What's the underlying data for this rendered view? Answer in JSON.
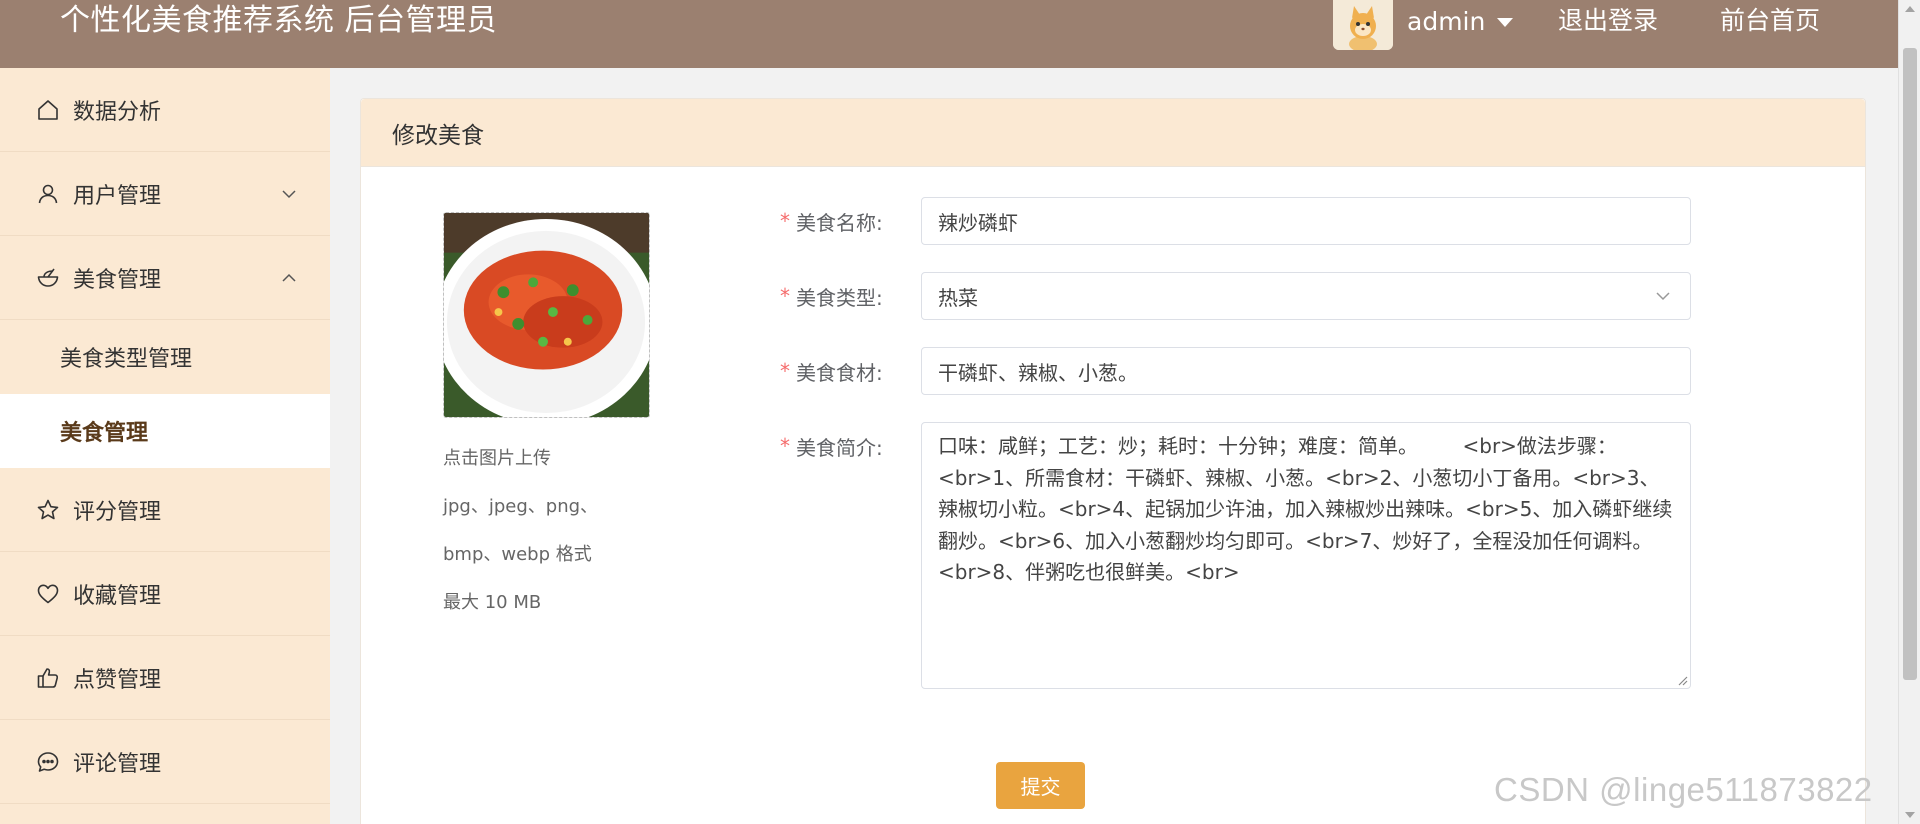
{
  "header": {
    "title": "个性化美食推荐系统 后台管理员",
    "username": "admin",
    "logout": "退出登录",
    "home": "前台首页",
    "avatar_icon": "cartoon-cat-avatar",
    "background": "#9b8070"
  },
  "sidebar": {
    "background": "#fbe9d3",
    "items": [
      {
        "label": "数据分析",
        "icon": "home-icon"
      },
      {
        "label": "用户管理",
        "icon": "user-icon",
        "arrow": "chevron-down"
      },
      {
        "label": "美食管理",
        "icon": "bowl-icon",
        "arrow": "chevron-up",
        "expanded": true
      },
      {
        "label": "美食类型管理",
        "sub": true
      },
      {
        "label": "美食管理",
        "sub": true,
        "active": true
      },
      {
        "label": "评分管理",
        "icon": "star-icon"
      },
      {
        "label": "收藏管理",
        "icon": "heart-icon"
      },
      {
        "label": "点赞管理",
        "icon": "thumb-up-icon"
      },
      {
        "label": "评论管理",
        "icon": "comment-icon"
      }
    ]
  },
  "card": {
    "title": "修改美食"
  },
  "upload": {
    "image_icon": "fried-shrimp-dish-image",
    "hint1": "点击图片上传",
    "hint2": "jpg、jpeg、png、",
    "hint3": "bmp、webp 格式",
    "hint4": "最大 10 MB"
  },
  "form": {
    "name_label": "美食名称:",
    "name_value": "辣炒磷虾",
    "type_label": "美食类型:",
    "type_value": "热菜",
    "ingredients_label": "美食食材:",
    "ingredients_value": "干磷虾、辣椒、小葱。",
    "intro_label": "美食简介:",
    "intro_value": "口味：咸鲜；工艺：炒；耗时：十分钟；难度：简单。       <br>做法步骤：<br>1、所需食材：干磷虾、辣椒、小葱。<br>2、小葱切小丁备用。<br>3、辣椒切小粒。<br>4、起锅加少许油，加入辣椒炒出辣味。<br>5、加入磷虾继续翻炒。<br>6、加入小葱翻炒均匀即可。<br>7、炒好了，全程没加任何调料。<br>8、伴粥吃也很鲜美。<br>",
    "submit": "提交",
    "submit_color": "#e9a43f",
    "required_mark": "*"
  },
  "watermark": "CSDN @linge511873822"
}
